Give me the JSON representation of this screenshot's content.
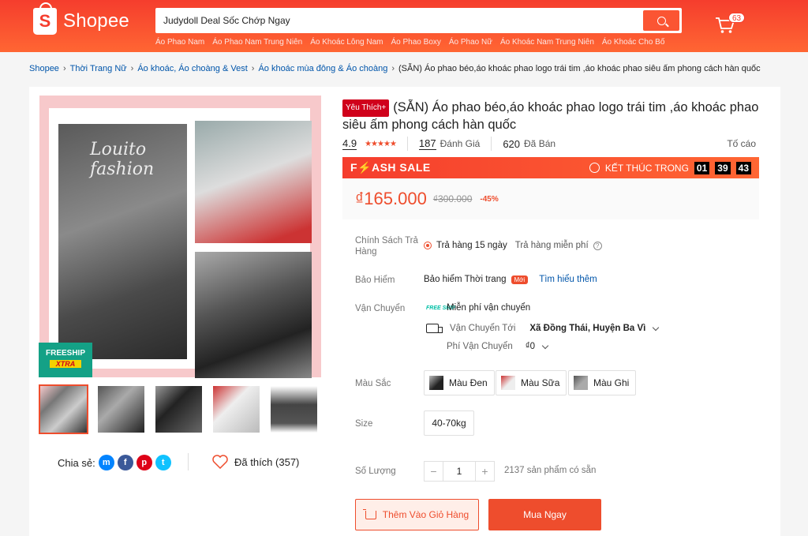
{
  "header": {
    "logo_text": "Shopee",
    "search_value": "Judydoll Deal Sốc Chớp Ngay",
    "suggestions": [
      "Áo Phao Nam",
      "Áo Phao Nam Trung Niên",
      "Áo Khoác Lông Nam",
      "Áo Phao Boxy",
      "Áo Phao Nữ",
      "Áo Khoác Nam Trung Niên",
      "Áo Khoác Cho Bố"
    ],
    "cart_count": "63"
  },
  "breadcrumb": [
    "Shopee",
    "Thời Trang Nữ",
    "Áo khoác, Áo choàng & Vest",
    "Áo khoác mùa đông & Áo choàng",
    "(SẴN) Áo phao béo,áo khoác phao logo trái tim ,áo khoác phao siêu ấm phong cách hàn quốc"
  ],
  "gallery": {
    "watermark": "Louito fashion",
    "freeship_line1": "FREESHIP",
    "freeship_line2": "XTRA",
    "share_label": "Chia sẻ:",
    "like_label": "Đã thích (357)"
  },
  "product": {
    "badge": "Yêu Thích+",
    "title": "(SẴN) Áo phao béo,áo khoác phao logo trái tim ,áo khoác phao siêu ấm phong cách hàn quốc",
    "rating": "4.9",
    "reviews_count": "187",
    "reviews_label": "Đánh Giá",
    "sold_count": "620",
    "sold_label": "Đã Bán",
    "report_label": "Tố cáo"
  },
  "flash_sale": {
    "title": "F⚡ASH SALE",
    "ends_label": "KẾT THÚC TRONG",
    "hours": "01",
    "minutes": "39",
    "seconds": "43"
  },
  "price": {
    "current": "₫165.000",
    "original": "₫300.000",
    "discount": "-45%"
  },
  "return_policy": {
    "label": "Chính Sách Trả Hàng",
    "value": "Trả hàng 15 ngày",
    "note": "Trả hàng miễn phí"
  },
  "insurance": {
    "label": "Bảo Hiểm",
    "value": "Bảo hiểm Thời trang",
    "badge": "Mới",
    "link": "Tìm hiểu thêm"
  },
  "shipping": {
    "label": "Vận Chuyển",
    "free_icon_text": "FREE SHIP",
    "free_text": "Miễn phí vận chuyển",
    "to_label": "Vận Chuyển Tới",
    "to_value": "Xã Đồng Thái, Huyện Ba Vì",
    "fee_label": "Phí Vận Chuyển",
    "fee_value": "₫0"
  },
  "colors": {
    "label": "Màu Sắc",
    "options": [
      "Màu Đen",
      "Màu Sữa",
      "Màu Ghi"
    ]
  },
  "size": {
    "label": "Size",
    "options": [
      "40-70kg"
    ]
  },
  "quantity": {
    "label": "Số Lượng",
    "value": "1",
    "minus": "−",
    "plus": "+",
    "stock": "2137 sản phẩm có sẵn"
  },
  "actions": {
    "add_to_cart": "Thêm Vào Giỏ Hàng",
    "buy_now": "Mua Ngay"
  },
  "theme": {
    "brand": "#ee4d2d",
    "link": "#0055aa"
  }
}
